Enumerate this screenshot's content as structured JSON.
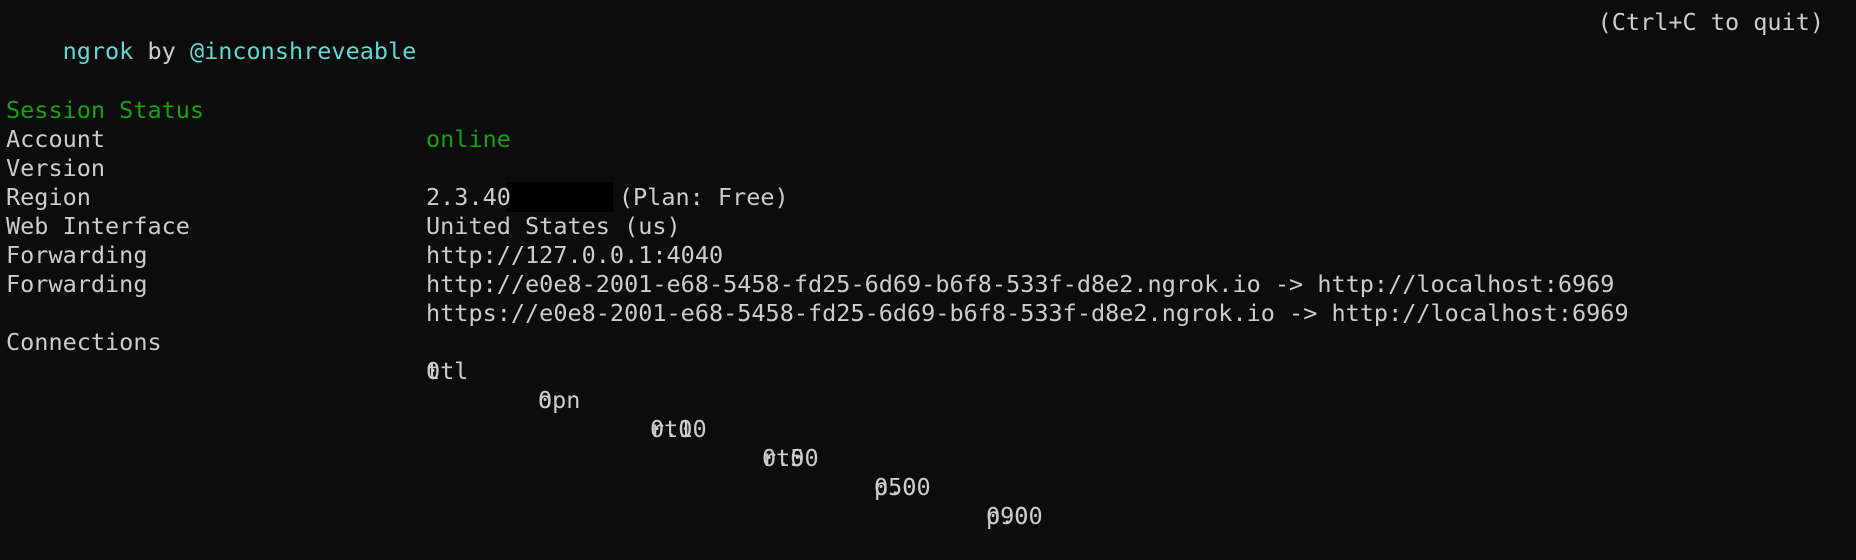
{
  "header": {
    "app_name": "ngrok",
    "by_text": " by ",
    "author": "@inconshreveable",
    "quit_hint": "(Ctrl+C to quit)"
  },
  "session": {
    "status_label": "Session Status",
    "status_value": "online",
    "account_label": "Account",
    "account_plan": "(Plan: Free)",
    "version_label": "Version",
    "version_value": "2.3.40",
    "region_label": "Region",
    "region_value": "United States (us)",
    "web_interface_label": "Web Interface",
    "web_interface_value": "http://127.0.0.1:4040",
    "forwarding": [
      {
        "label": "Forwarding",
        "value": "http://e0e8-2001-e68-5458-fd25-6d69-b6f8-533f-d8e2.ngrok.io -> http://localhost:6969"
      },
      {
        "label": "Forwarding",
        "value": "https://e0e8-2001-e68-5458-fd25-6d69-b6f8-533f-d8e2.ngrok.io -> http://localhost:6969"
      }
    ]
  },
  "connections": {
    "label": "Connections",
    "headers": [
      "ttl",
      "opn",
      "rt1",
      "rt5",
      "p50",
      "p90"
    ],
    "values": [
      "0",
      "0",
      "0.00",
      "0.00",
      "0.00",
      "0.00"
    ]
  },
  "colors": {
    "background": "#0c0c0c",
    "text": "#cccccc",
    "cyan": "#61d6d6",
    "green": "#13a10e",
    "redaction": "#000000"
  }
}
